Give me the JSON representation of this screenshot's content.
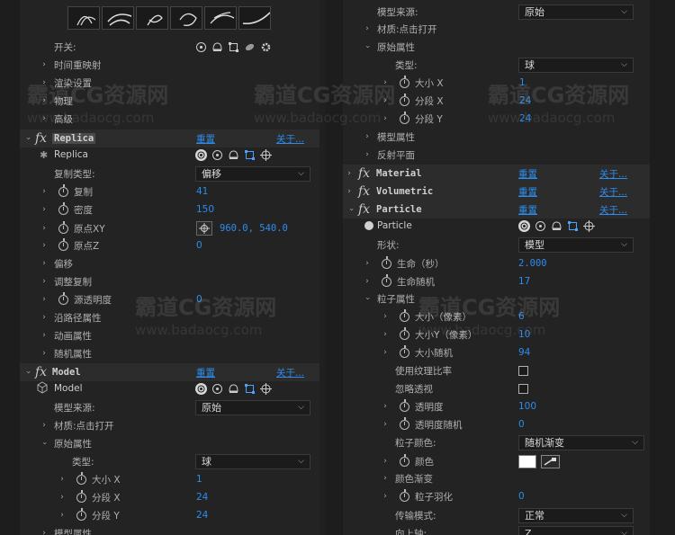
{
  "watermark": {
    "brand": "霸道CG资源网",
    "url": "www.badaocg.com"
  },
  "left": {
    "switch_label": "开关:",
    "sections_top": [
      "时间重映射",
      "渲染设置",
      "物理",
      "高级"
    ],
    "replica": {
      "name": "Replica",
      "reset": "重置",
      "about": "关于...",
      "sub_name": "Replica",
      "copy_type_label": "复制类型:",
      "copy_type_value": "偏移",
      "params": [
        {
          "label": "复制",
          "value": "41"
        },
        {
          "label": "密度",
          "value": "150"
        },
        {
          "label": "原点XY",
          "value": "960.0, 540.0"
        },
        {
          "label": "原点Z",
          "value": "0"
        }
      ],
      "sections": [
        "偏移",
        "调整复制"
      ],
      "opacity_label": "源透明度",
      "opacity_value": "0",
      "sections2": [
        "沿路径属性",
        "动画属性",
        "随机属性"
      ]
    },
    "model": {
      "name": "Model",
      "reset": "重置",
      "about": "关于...",
      "sub_name": "Model",
      "source_label": "模型来源:",
      "source_value": "原始",
      "material": "材质:点击打开",
      "orig_props": "原始属性",
      "type_label": "类型:",
      "type_value": "球",
      "params": [
        {
          "label": "大小 X",
          "value": "1"
        },
        {
          "label": "分段 X",
          "value": "24"
        },
        {
          "label": "分段 Y",
          "value": "24"
        }
      ],
      "next_section": "模型属性"
    }
  },
  "right": {
    "source_label": "模型来源:",
    "source_value": "原始",
    "material": "材质:点击打开",
    "orig_props": "原始属性",
    "type_label": "类型:",
    "type_value": "球",
    "params": [
      {
        "label": "大小 X",
        "value": "1"
      },
      {
        "label": "分段 X",
        "value": "24"
      },
      {
        "label": "分段 Y",
        "value": "24"
      }
    ],
    "sections": [
      "模型属性",
      "反射平面"
    ],
    "effects": [
      {
        "name": "Material",
        "reset": "重置",
        "about": "关于..."
      },
      {
        "name": "Volumetric",
        "reset": "重置",
        "about": "关于..."
      },
      {
        "name": "Particle",
        "reset": "重置",
        "about": "关于..."
      }
    ],
    "particle": {
      "sub_name": "Particle",
      "shape_label": "形状:",
      "shape_value": "模型",
      "life_label": "生命（秒）",
      "life_value": "2.000",
      "life_rand_label": "生命随机",
      "life_rand_value": "17",
      "props_label": "粒子属性",
      "props": [
        {
          "label": "大小（像素）",
          "value": "6"
        },
        {
          "label": "大小Y（像素）",
          "value": "10"
        },
        {
          "label": "大小随机",
          "value": "94"
        }
      ],
      "use_tex_ratio": "使用纹理比率",
      "ignore_persp": "忽略透视",
      "opacity_label": "透明度",
      "opacity_value": "100",
      "opacity_rand_label": "透明度随机",
      "opacity_rand_value": "0",
      "color_label": "粒子颜色:",
      "color_value": "随机渐变",
      "color_sub": "颜色",
      "gradient": "颜色渐变",
      "feather_label": "粒子羽化",
      "feather_value": "0",
      "transfer_label": "传输模式:",
      "transfer_value": "正常",
      "up_label": "向上轴:",
      "up_value": "Z"
    }
  }
}
